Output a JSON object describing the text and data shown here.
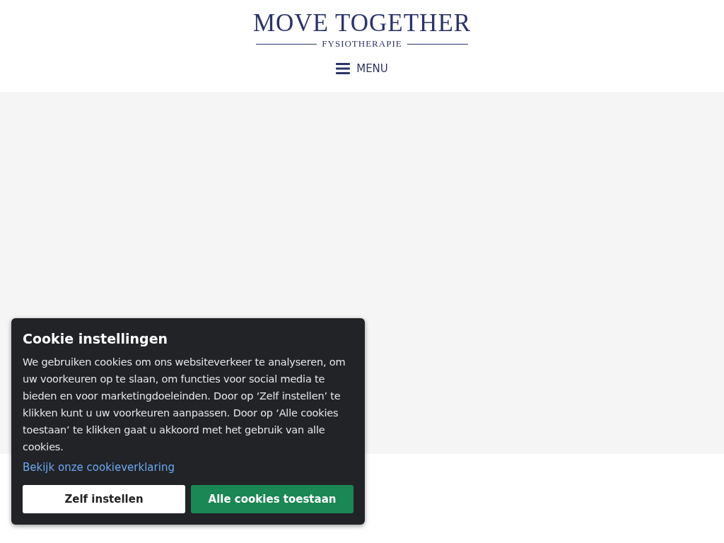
{
  "logo": {
    "title": "MOVE TOGETHER",
    "subtitle": "FYSIOTHERAPIE"
  },
  "menu": {
    "label": "MENU"
  },
  "cookie_dialog": {
    "title": "Cookie instellingen",
    "text": "We gebruiken cookies om ons websiteverkeer te analyseren, om uw voorkeuren op te slaan, om functies voor social media te bieden en voor marketingdoeleinden. Door op ‘Zelf instellen’ te klikken kunt u uw voorkeuren aanpassen. Door op ‘Alle cookies toestaan’ te klikken gaat u akkoord met het gebruik van alle cookies.",
    "link": "Bekijk onze cookieverklaring",
    "buttons": [
      {
        "label": "Zelf instellen",
        "kind": "secondary"
      },
      {
        "label": "Alle cookies toestaan",
        "kind": "primary"
      }
    ]
  }
}
